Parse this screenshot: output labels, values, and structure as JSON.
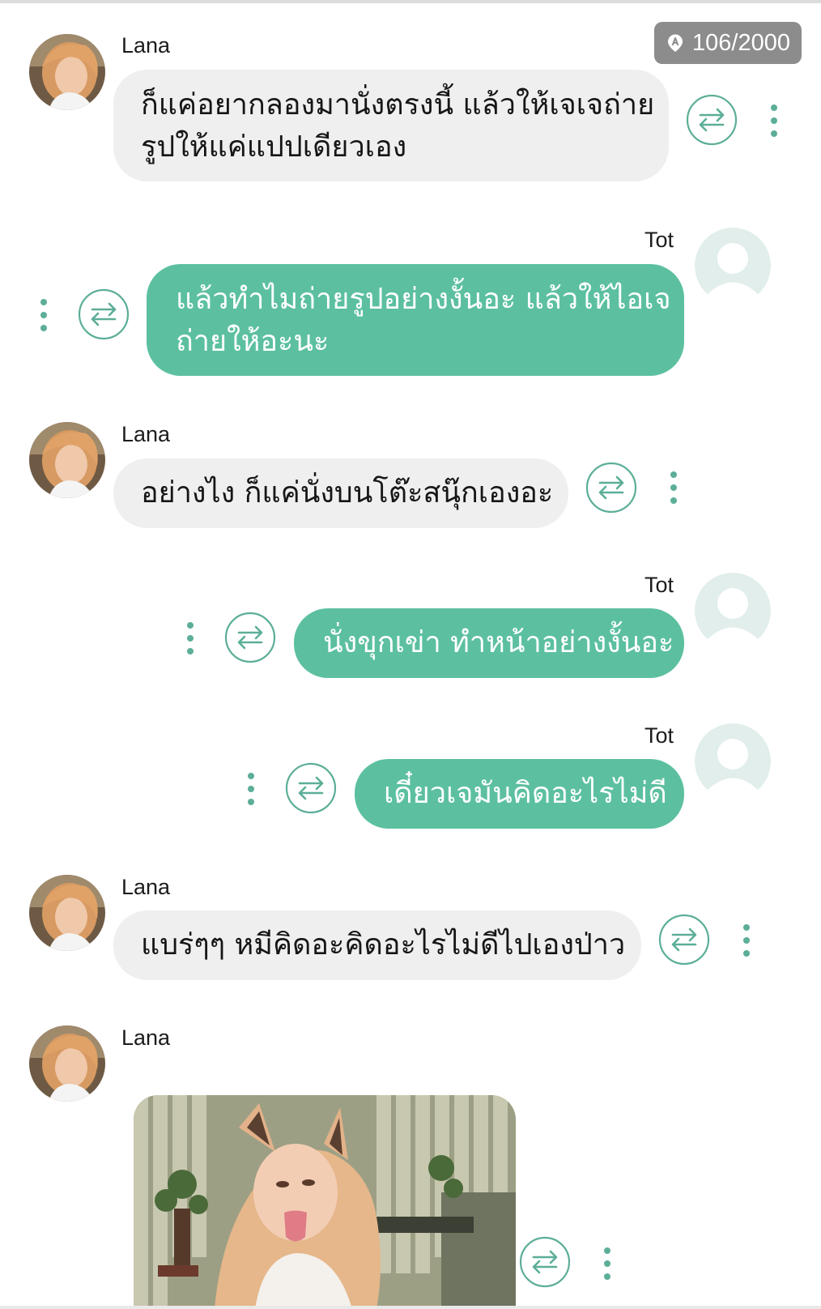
{
  "header": {
    "counter_text": "106/2000",
    "counter_icon": "map-pin-a-icon"
  },
  "colors": {
    "accent": "#5cc0a0",
    "incoming_bubble": "#efefef",
    "counter_badge": "#8c8c8c",
    "icon_stroke": "#5cae98"
  },
  "messages": [
    {
      "sender": "Lana",
      "direction": "incoming",
      "lines": [
        "ก็แค่อยากลองมานั่งตรงนี้ แล้วให้เจเจถ่าย",
        "รูปให้แค่แปปเดียวเอง"
      ]
    },
    {
      "sender": "Tot",
      "direction": "outgoing",
      "lines": [
        "แล้วทำไมถ่ายรูปอย่างงั้นอะ แล้วให้ไอเจ",
        "ถ่ายให้อะนะ"
      ]
    },
    {
      "sender": "Lana",
      "direction": "incoming",
      "lines": [
        "อย่างไง ก็แค่นั่งบนโต๊ะสนุ๊กเองอะ"
      ]
    },
    {
      "sender": "Tot",
      "direction": "outgoing",
      "lines": [
        "นั่งขุกเข่า ทำหน้าอย่างงั้นอะ"
      ]
    },
    {
      "sender": "Tot",
      "direction": "outgoing",
      "lines": [
        "เดี๋ยวเจมันคิดอะไรไม่ดี"
      ]
    },
    {
      "sender": "Lana",
      "direction": "incoming",
      "lines": [
        "แบร่ๆๆ หมีคิดอะคิดอะไรไม่ดีไปเองป่าว"
      ]
    },
    {
      "sender": "Lana",
      "direction": "incoming",
      "kind": "photo"
    }
  ]
}
